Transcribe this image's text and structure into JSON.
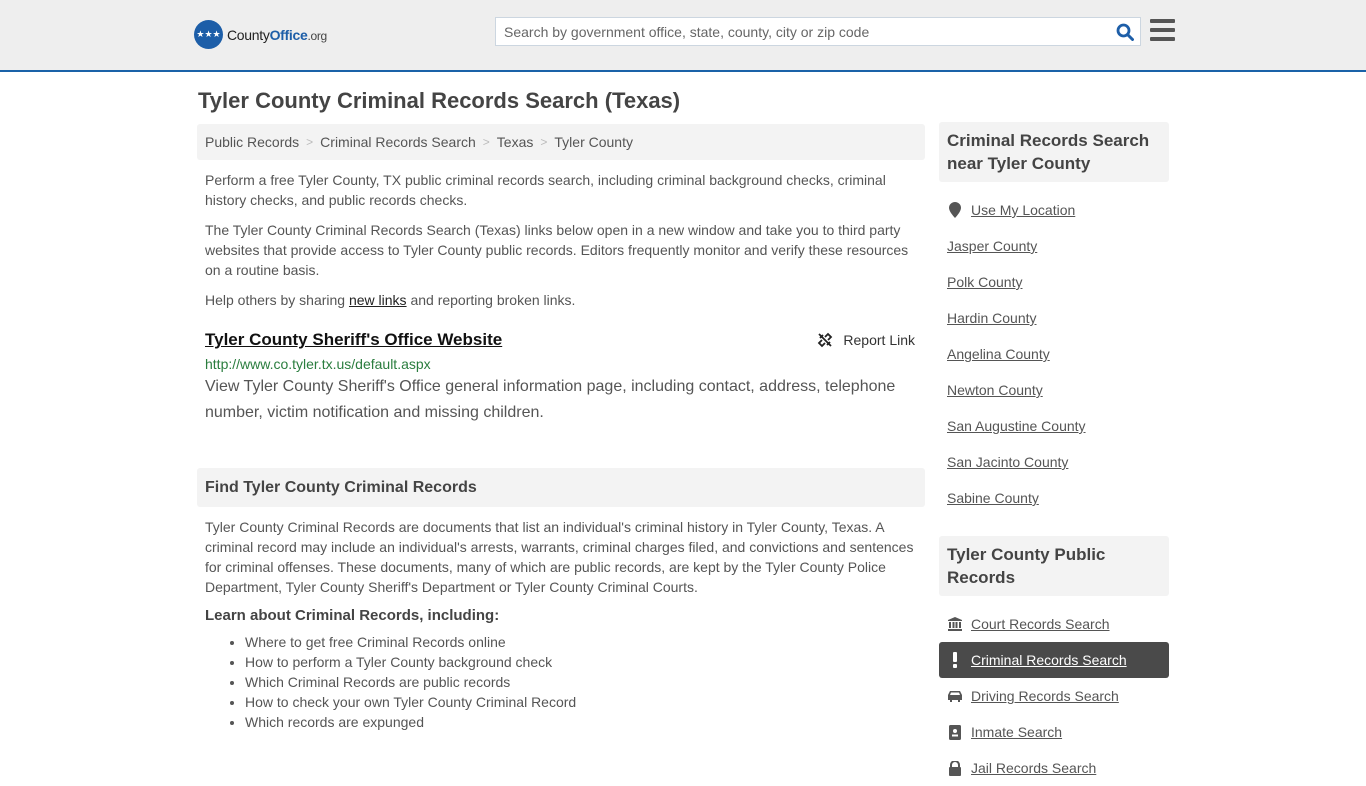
{
  "header": {
    "logo": {
      "county": "County",
      "office": "Office",
      "org": ".org"
    },
    "search_placeholder": "Search by government office, state, county, city or zip code",
    "search_icon": "search-icon",
    "menu_icon": "hamburger-menu-icon"
  },
  "page": {
    "title": "Tyler County Criminal Records Search (Texas)"
  },
  "breadcrumb": [
    "Public Records",
    "Criminal Records Search",
    "Texas",
    "Tyler County"
  ],
  "intro": {
    "p1": "Perform a free Tyler County, TX public criminal records search, including criminal background checks, criminal history checks, and public records checks.",
    "p2": "The Tyler County Criminal Records Search (Texas) links below open in a new window and take you to third party websites that provide access to Tyler County public records. Editors frequently monitor and verify these resources on a routine basis.",
    "p3_before": "Help others by sharing ",
    "p3_link": "new links",
    "p3_after": " and reporting broken links."
  },
  "listing": {
    "title": "Tyler County Sheriff's Office Website",
    "report_label": "Report Link",
    "url": "http://www.co.tyler.tx.us/default.aspx",
    "description": "View Tyler County Sheriff's Office general information page, including contact, address, telephone number, victim notification and missing children."
  },
  "find_section": {
    "heading": "Find Tyler County Criminal Records",
    "text": "Tyler County Criminal Records are documents that list an individual's criminal history in Tyler County, Texas. A criminal record may include an individual's arrests, warrants, criminal charges filed, and convictions and sentences for criminal offenses. These documents, many of which are public records, are kept by the Tyler County Police Department, Tyler County Sheriff's Department or Tyler County Criminal Courts.",
    "learn_heading": "Learn about Criminal Records, including:",
    "bullets": [
      "Where to get free Criminal Records online",
      "How to perform a Tyler County background check",
      "Which Criminal Records are public records",
      "How to check your own Tyler County Criminal Record",
      "Which records are expunged"
    ]
  },
  "sidebar": {
    "nearby_heading": "Criminal Records Search near Tyler County",
    "use_location": "Use My Location",
    "nearby": [
      "Jasper County",
      "Polk County",
      "Hardin County",
      "Angelina County",
      "Newton County",
      "San Augustine County",
      "San Jacinto County",
      "Sabine County"
    ],
    "public_heading": "Tyler County Public Records",
    "public_items": [
      {
        "label": "Court Records Search",
        "icon": "courthouse-icon",
        "active": false
      },
      {
        "label": "Criminal Records Search",
        "icon": "exclamation-icon",
        "active": true
      },
      {
        "label": "Driving Records Search",
        "icon": "car-icon",
        "active": false
      },
      {
        "label": "Inmate Search",
        "icon": "id-badge-icon",
        "active": false
      },
      {
        "label": "Jail Records Search",
        "icon": "lock-icon",
        "active": false
      }
    ]
  }
}
